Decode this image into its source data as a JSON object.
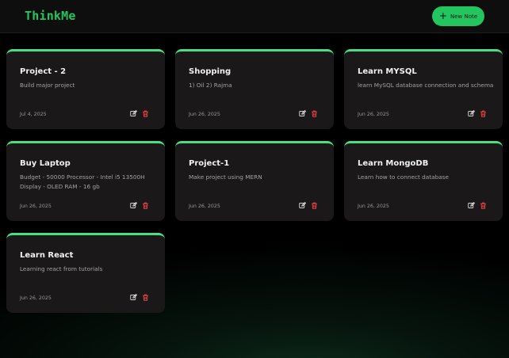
{
  "header": {
    "logo": "ThinkMe",
    "new_note_label": "New Note"
  },
  "colors": {
    "accent": "#22c55e",
    "card_border": "#4ade80",
    "delete_icon": "#ef4444",
    "edit_icon": "#d4d4d4",
    "card_bg": "#1a1818"
  },
  "icons": {
    "add": "plus-icon",
    "edit": "edit-icon",
    "delete": "trash-icon"
  },
  "notes": [
    {
      "title": "Project - 2",
      "description": "Build major project",
      "date": "Jul 4, 2025"
    },
    {
      "title": "Shopping",
      "description": "1) Oil 2) Rajma",
      "date": "Jun 26, 2025"
    },
    {
      "title": "Learn MYSQL",
      "description": "learn MySQL database connection and schema",
      "date": "Jun 26, 2025"
    },
    {
      "title": "Buy Laptop",
      "description": "Budget - 50000 Processor - Intel i5 13500H Display - OLED RAM - 16 gb",
      "date": "Jun 26, 2025"
    },
    {
      "title": "Project-1",
      "description": "Make project using MERN",
      "date": "Jun 26, 2025"
    },
    {
      "title": "Learn MongoDB",
      "description": "Learn how to connect database",
      "date": "Jun 26, 2025"
    },
    {
      "title": "Learn React",
      "description": "Learning react from tutorials",
      "date": "Jun 26, 2025"
    }
  ]
}
